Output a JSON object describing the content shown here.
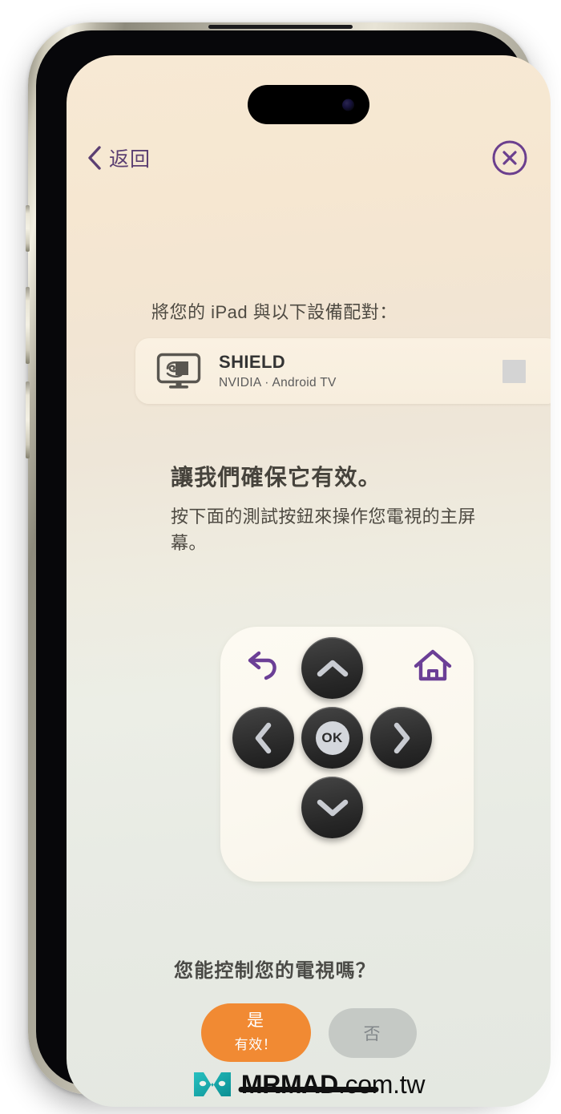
{
  "nav": {
    "back_label": "返回",
    "back_icon": "chevron-left-icon",
    "close_icon": "close-circle-icon"
  },
  "pair": {
    "title": "將您的 iPad 與以下設備配對：",
    "device": {
      "icon": "tv-nvidia-shield-icon",
      "name": "SHIELD",
      "subtitle": "NVIDIA · Android TV",
      "status_placeholder": ""
    }
  },
  "verify": {
    "heading": "讓我們確保它有效。",
    "body": "按下面的測試按鈕來操作您電視的主屏幕。"
  },
  "remote": {
    "back_icon": "undo-arrow-icon",
    "home_icon": "home-icon",
    "up_icon": "chevron-up-icon",
    "left_icon": "chevron-left-icon",
    "right_icon": "chevron-right-icon",
    "down_icon": "chevron-down-icon",
    "ok_label": "OK"
  },
  "question": {
    "text": "您能控制您的電視嗎？",
    "yes_main": "是",
    "yes_sub": "有效！",
    "no_label": "否"
  },
  "watermark": {
    "logo_icon": "mrmad-logo-icon",
    "brand": "MRMAD",
    "domain": ".com.tw"
  },
  "colors": {
    "accent_purple": "#5b3f72",
    "icon_purple": "#7a4aa0",
    "yes_orange": "#f18a33",
    "no_gray": "#c5c9c5",
    "background_top": "#f7e9d4",
    "background_bottom": "#e4e8e1",
    "logo_teal": "#11a3a3"
  }
}
